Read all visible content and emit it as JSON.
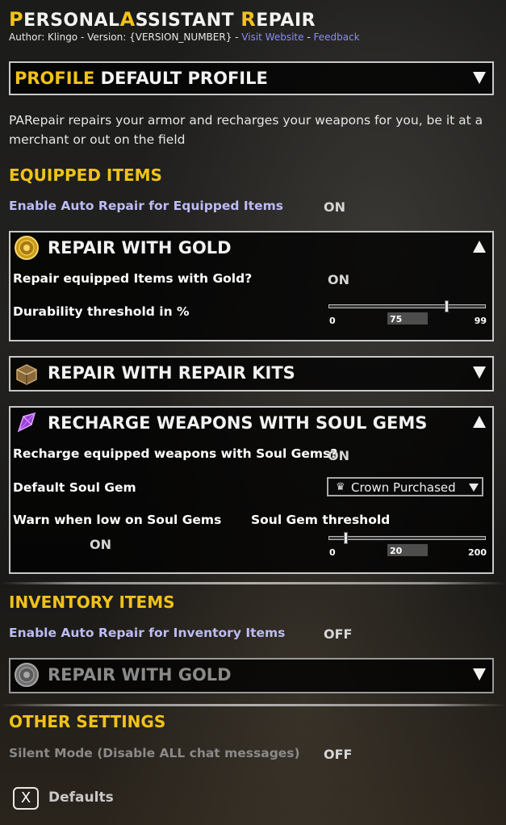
{
  "header": {
    "title_p": "P",
    "title_p_rest": "ERSONAL",
    "title_a": "A",
    "title_a_rest": "SSISTANT ",
    "title_r": "R",
    "title_r_rest": "EPAIR",
    "author": "Author: Klingo - Version: {VERSION_NUMBER} - ",
    "visit_website": "Visit Website",
    "dash": " - ",
    "feedback": "Feedback"
  },
  "profile": {
    "accent": "PROFILE",
    "value": "DEFAULT PROFILE"
  },
  "description": "PARepair repairs your armor and recharges your weapons for you, be it at a merchant or out on the field",
  "equipped": {
    "heading": "EQUIPPED ITEMS",
    "auto_label": "Enable Auto Repair for Equipped Items",
    "auto_value": "ON",
    "gold": {
      "title": "REPAIR WITH GOLD",
      "repair_label": "Repair equipped Items with Gold?",
      "repair_value": "ON",
      "threshold_label": "Durability threshold in %",
      "slider": {
        "min": "0",
        "max": "99",
        "value": "75",
        "fraction": 0.76
      }
    },
    "kits": {
      "title": "REPAIR WITH REPAIR KITS"
    },
    "soulgems": {
      "title": "RECHARGE WEAPONS WITH SOUL GEMS",
      "recharge_label": "Recharge equipped weapons with Soul Gems?",
      "recharge_value": "ON",
      "default_label": "Default Soul Gem",
      "default_value": "Crown Purchased",
      "warn_label": "Warn when low on Soul Gems",
      "warn_value": "ON",
      "threshold_label": "Soul Gem threshold",
      "slider": {
        "min": "0",
        "max": "200",
        "value": "20",
        "fraction": 0.1
      }
    }
  },
  "inventory": {
    "heading": "INVENTORY ITEMS",
    "auto_label": "Enable Auto Repair for Inventory Items",
    "auto_value": "OFF",
    "gold": {
      "title": "REPAIR WITH GOLD"
    }
  },
  "other": {
    "heading": "OTHER SETTINGS",
    "silent_label": "Silent Mode (Disable ALL chat messages)",
    "silent_value": "OFF"
  },
  "footer": {
    "key": "X",
    "label": "Defaults"
  }
}
